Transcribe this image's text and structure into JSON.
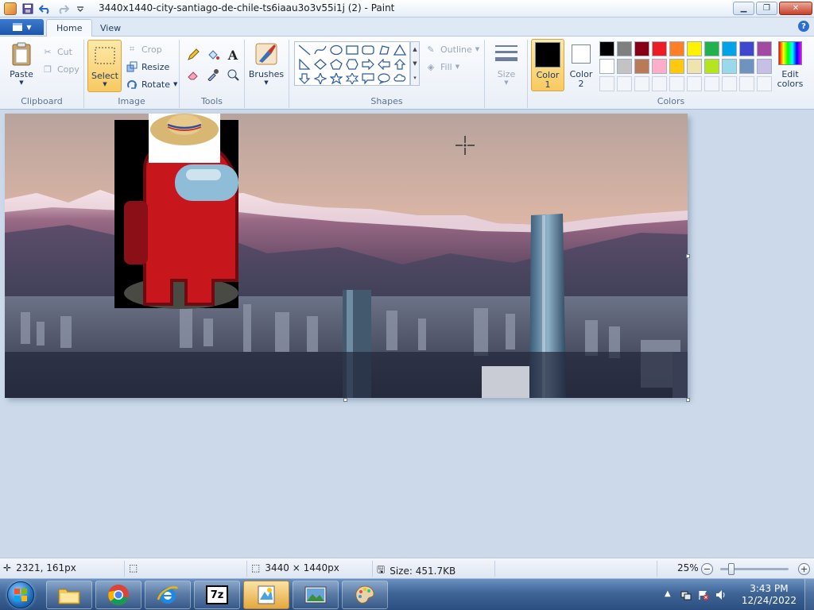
{
  "window": {
    "title": "3440x1440-city-santiago-de-chile-ts6iaau3o3v55i1j (2) - Paint",
    "minimize_icon": "minimize-icon",
    "maximize_icon": "restore-icon",
    "close_icon": "close-icon"
  },
  "tabs": [
    {
      "label": "Home",
      "active": true
    },
    {
      "label": "View",
      "active": false
    }
  ],
  "ribbon": {
    "clipboard": {
      "label": "Clipboard",
      "paste": "Paste",
      "cut": "Cut",
      "copy": "Copy"
    },
    "image": {
      "label": "Image",
      "select": "Select",
      "crop": "Crop",
      "resize": "Resize",
      "rotate": "Rotate"
    },
    "tools": {
      "label": "Tools"
    },
    "brushes": {
      "label": "Brushes"
    },
    "shapes": {
      "label": "Shapes",
      "outline": "Outline",
      "fill": "Fill"
    },
    "size": {
      "label": "Size"
    },
    "colors": {
      "label": "Colors",
      "color1": "Color\n1",
      "color1_line1": "Color",
      "color1_line2": "1",
      "color2_line1": "Color",
      "color2_line2": "2",
      "edit_line1": "Edit",
      "edit_line2": "colors",
      "color1_value": "#000000",
      "color2_value": "#ffffff",
      "palette_row1": [
        "#000000",
        "#7f7f7f",
        "#880015",
        "#ed1c24",
        "#ff7f27",
        "#fff200",
        "#22b14c",
        "#00a2e8",
        "#3f48cc",
        "#a349a4"
      ],
      "palette_row2": [
        "#ffffff",
        "#c3c3c3",
        "#b97a57",
        "#ffaec9",
        "#ffc90e",
        "#efe4b0",
        "#b5e61d",
        "#99d9ea",
        "#7092be",
        "#c8bfe7"
      ]
    }
  },
  "status": {
    "cursor_pos": "2321, 161px",
    "image_size": "3440 × 1440px",
    "file_size": "Size: 451.7KB",
    "zoom": "25%",
    "zoom_level_fraction": 0.25
  },
  "taskbar": {
    "time": "3:43 PM",
    "date": "12/24/2022",
    "apps": [
      "file-explorer-icon",
      "chrome-icon",
      "ie-icon",
      "7zip-icon",
      "paint-icon",
      "photo-viewer-icon",
      "paint-alt-icon"
    ]
  },
  "taskbar_7z": "7z"
}
